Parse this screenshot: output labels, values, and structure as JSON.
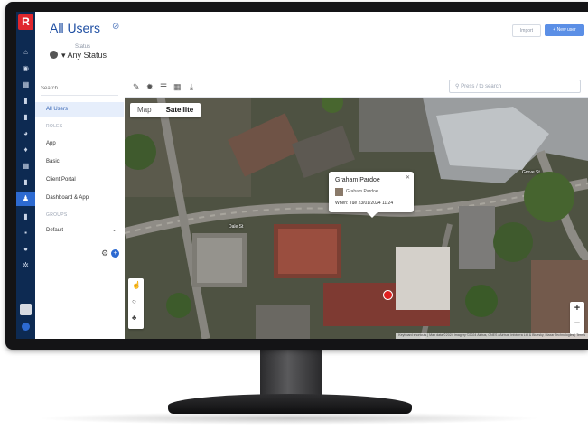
{
  "app": {
    "logo_letter": "R",
    "title": "All Users",
    "accent": "#2d6ad1",
    "rail_color": "#0d2a52",
    "logo_color": "#e0272d"
  },
  "header": {
    "status_label": "Status",
    "status_value": "Any Status",
    "import_label": "Import",
    "new_user_label": "+ New user"
  },
  "sidebar": {
    "search_placeholder": "Search",
    "all_users": "All Users",
    "roles_header": "ROLES",
    "roles": [
      "App",
      "Basic",
      "Client Portal",
      "Dashboard & App"
    ],
    "groups_header": "GROUPS",
    "group_selected": "Default"
  },
  "toolbar": {
    "search_placeholder": "Press / to search",
    "icons": [
      "edit-icon",
      "gear-icon",
      "list-icon",
      "table-icon",
      "download-icon"
    ]
  },
  "map": {
    "map_type_map": "Map",
    "map_type_satellite": "Satellite",
    "popup": {
      "name": "Graham Pardoe",
      "user": "Graham Pardoe",
      "when": "When: Tue 23/01/2024 11:24"
    },
    "zoom_in": "+",
    "zoom_out": "−",
    "attribution": "Keyboard shortcuts | Map data ©2024 Imagery ©2024 Airbus, CNES / Airbus, Infoterra Ltd & Bluesky, Maxar Technologies | Terms",
    "road_labels": [
      "Dale St",
      "Grove St"
    ],
    "marker_color": "#e02020"
  }
}
